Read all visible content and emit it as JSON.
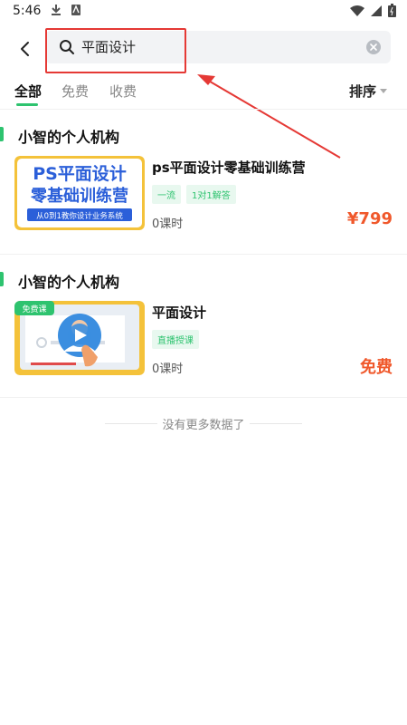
{
  "status_bar": {
    "time": "5:46"
  },
  "search": {
    "query": "平面设计"
  },
  "tabs": [
    {
      "label": "全部"
    },
    {
      "label": "免费"
    },
    {
      "label": "收费"
    }
  ],
  "sort": {
    "label": "排序"
  },
  "courses": [
    {
      "org": "小智的个人机构",
      "thumb": {
        "line1": "PS平面设计",
        "line2": "零基础训练营",
        "sub": "从0到1教你设计业务系统"
      },
      "title": "ps平面设计零基础训练营",
      "tags": [
        "一流",
        "1对1解答"
      ],
      "lessons": "0课时",
      "price": "¥799"
    },
    {
      "org": "小智的个人机构",
      "thumb": {
        "badge": "免费课"
      },
      "title": "平面设计",
      "tags": [
        "直播授课"
      ],
      "lessons": "0课时",
      "price": "免费"
    }
  ],
  "footer": {
    "no_more": "没有更多数据了"
  },
  "colors": {
    "accent": "#2ec36f",
    "price": "#f0582b",
    "highlight": "#e53935"
  }
}
